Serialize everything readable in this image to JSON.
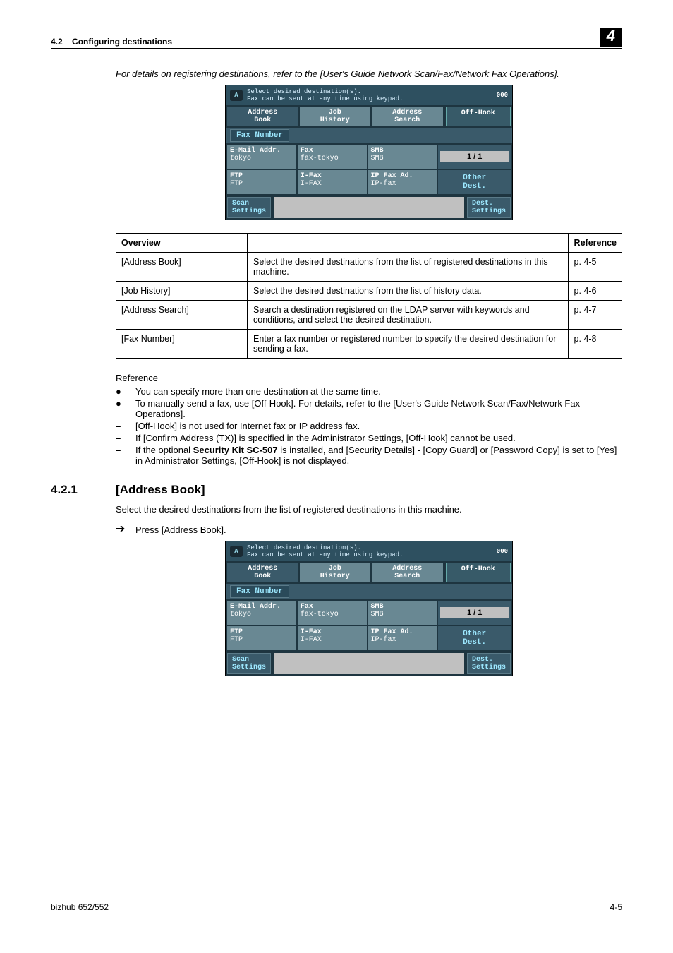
{
  "header": {
    "section": "4.2",
    "title": "Configuring destinations",
    "chapter": "4"
  },
  "intro": "For details on registering destinations, refer to the [User's Guide Network Scan/Fax/Network Fax Operations].",
  "screenshot": {
    "topline1": "Select desired destination(s).",
    "topline2": "Fax can be sent at any time using keypad.",
    "topnum": "000",
    "tabs": [
      "Address\nBook",
      "Job\nHistory",
      "Address\nSearch"
    ],
    "offhook": "Off-Hook",
    "faxnum": "Fax Number",
    "cells": [
      {
        "l1": "E-Mail Addr.",
        "l2": "tokyo"
      },
      {
        "l1": "Fax",
        "l2": "fax-tokyo"
      },
      {
        "l1": "SMB",
        "l2": "SMB"
      },
      {
        "l1": "FTP",
        "l2": "FTP"
      },
      {
        "l1": "I-Fax",
        "l2": "I-FAX"
      },
      {
        "l1": "IP Fax Ad.",
        "l2": "IP-fax"
      }
    ],
    "page": "1 /   1",
    "other": "Other\nDest.",
    "scan": "Scan\nSettings",
    "dest": "Dest.\nSettings"
  },
  "table": {
    "head": [
      "Overview",
      "",
      "Reference"
    ],
    "rows": [
      [
        "[Address Book]",
        "Select the desired destinations from the list of registered destinations in this machine.",
        "p. 4-5"
      ],
      [
        "[Job History]",
        "Select the desired destinations from the list of history data.",
        "p. 4-6"
      ],
      [
        "[Address Search]",
        "Search a destination registered on the LDAP server with keywords and conditions, and select the desired destination.",
        "p. 4-7"
      ],
      [
        "[Fax Number]",
        "Enter a fax number or registered number to specify the desired destination for sending a fax.",
        "p. 4-8"
      ]
    ]
  },
  "reference": {
    "label": "Reference",
    "items": [
      {
        "b": "●",
        "t": "You can specify more than one destination at the same time."
      },
      {
        "b": "●",
        "t": "To manually send a fax, use [Off-Hook]. For details, refer to the [User's Guide Network Scan/Fax/Network Fax Operations]."
      },
      {
        "b": "–",
        "t": "[Off-Hook] is not used for Internet fax or IP address fax."
      },
      {
        "b": "–",
        "t": "If [Confirm Address (TX)] is specified in the Administrator Settings, [Off-Hook] cannot be used."
      },
      {
        "b": "–",
        "t": "If the optional <b>Security Kit SC-507</b> is installed, and [Security Details] - [Copy Guard] or [Password Copy] is set to [Yes] in Administrator Settings, [Off-Hook] is not displayed."
      }
    ]
  },
  "section421": {
    "num": "4.2.1",
    "title": "[Address Book]"
  },
  "section421_body": "Select the desired destinations from the list of registered destinations in this machine.",
  "section421_step": "Press [Address Book].",
  "footer": {
    "left": "bizhub 652/552",
    "right": "4-5"
  }
}
